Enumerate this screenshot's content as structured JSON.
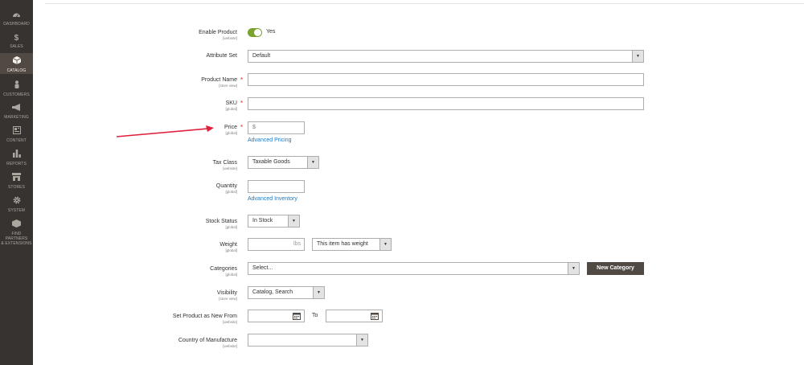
{
  "sidebar": {
    "items": [
      {
        "label": "DASHBOARD",
        "icon": "dashboard-icon"
      },
      {
        "label": "SALES",
        "icon": "dollar-icon"
      },
      {
        "label": "CATALOG",
        "icon": "cube-icon"
      },
      {
        "label": "CUSTOMERS",
        "icon": "person-icon"
      },
      {
        "label": "MARKETING",
        "icon": "megaphone-icon"
      },
      {
        "label": "CONTENT",
        "icon": "content-icon"
      },
      {
        "label": "REPORTS",
        "icon": "bar-chart-icon"
      },
      {
        "label": "STORES",
        "icon": "store-icon"
      },
      {
        "label": "SYSTEM",
        "icon": "gear-icon"
      },
      {
        "label1": "FIND PARTNERS",
        "label2": "& EXTENSIONS",
        "icon": "partners-icon"
      }
    ],
    "active_index": 2
  },
  "icons": {
    "dollar": "$"
  },
  "form": {
    "enable_product": {
      "label": "Enable Product",
      "scope": "[website]",
      "value": "Yes"
    },
    "attribute_set": {
      "label": "Attribute Set",
      "value": "Default"
    },
    "product_name": {
      "label": "Product Name",
      "scope": "[store view]",
      "value": ""
    },
    "sku": {
      "label": "SKU",
      "scope": "[global]",
      "value": ""
    },
    "price": {
      "label": "Price",
      "scope": "[global]",
      "prefix": "$",
      "link": "Advanced Pricing"
    },
    "tax_class": {
      "label": "Tax Class",
      "scope": "[website]",
      "value": "Taxable Goods"
    },
    "quantity": {
      "label": "Quantity",
      "scope": "[global]",
      "value": "",
      "link": "Advanced Inventory"
    },
    "stock_status": {
      "label": "Stock Status",
      "scope": "[global]",
      "value": "In Stock"
    },
    "weight": {
      "label": "Weight",
      "scope": "[global]",
      "unit": "lbs",
      "option": "This item has weight"
    },
    "categories": {
      "label": "Categories",
      "scope": "[global]",
      "placeholder": "Select...",
      "button": "New Category"
    },
    "visibility": {
      "label": "Visibility",
      "scope": "[store view]",
      "value": "Catalog, Search"
    },
    "new_from": {
      "label": "Set Product as New From",
      "scope": "[website]",
      "to_label": "To"
    },
    "country": {
      "label": "Country of Manufacture",
      "scope": "[website]",
      "value": ""
    }
  },
  "required_marker": "*",
  "colors": {
    "accent_link": "#1979c3",
    "toggle_on": "#79a22e",
    "required": "#e22626",
    "sidebar_bg": "#373330",
    "annotation_arrow": "#e0203a"
  }
}
